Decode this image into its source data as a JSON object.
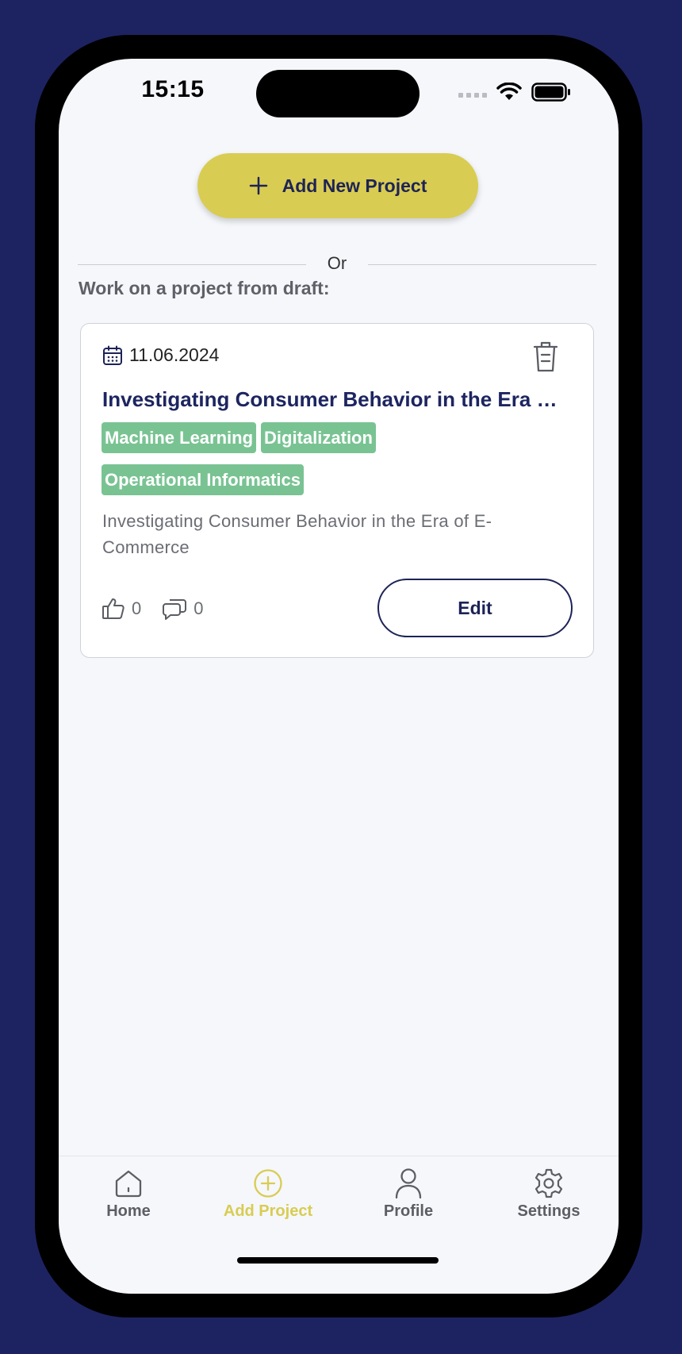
{
  "status": {
    "time": "15:15"
  },
  "actions": {
    "add_project": "Add New Project",
    "or": "Or"
  },
  "draft_section": {
    "label": "Work on a project from draft:"
  },
  "draft": {
    "date": "11.06.2024",
    "title": "Investigating Consumer Behavior in the Era of E-Commerce",
    "tags": [
      "Machine Learning",
      "Digitalization",
      "Operational Informatics"
    ],
    "description": "Investigating Consumer Behavior in the Era of E-Commerce",
    "likes": "0",
    "comments": "0",
    "edit_label": "Edit"
  },
  "tabs": [
    {
      "label": "Home",
      "icon": "home-icon",
      "active": false
    },
    {
      "label": "Add Project",
      "icon": "add-circle-icon",
      "active": true
    },
    {
      "label": "Profile",
      "icon": "user-icon",
      "active": false
    },
    {
      "label": "Settings",
      "icon": "gear-icon",
      "active": false
    }
  ],
  "colors": {
    "background": "#1d2361",
    "accent": "#d9cc52",
    "navy": "#1d2357",
    "tag_green": "#79c393"
  }
}
